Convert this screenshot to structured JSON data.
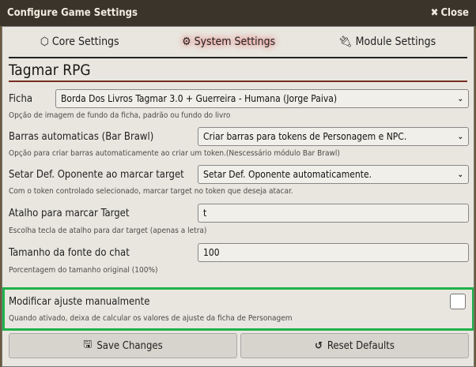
{
  "window": {
    "title": "Configure Game Settings",
    "close_label": "Close"
  },
  "tabs": [
    {
      "label": "Core Settings",
      "icon": "d20-icon"
    },
    {
      "label": "System Settings",
      "icon": "gears-icon",
      "active": true
    },
    {
      "label": "Module Settings",
      "icon": "plug-icon"
    }
  ],
  "section_title": "Tagmar RPG",
  "settings": [
    {
      "label": "Ficha",
      "value": "Borda Dos Livros Tagmar 3.0 + Guerreira - Humana (Jorge Paiva)",
      "hint": "Opção de imagem de fundo da ficha, padrão ou fundo do livro"
    },
    {
      "label": "Barras automaticas (Bar Brawl)",
      "value": "Criar barras para tokens de Personagem e NPC.",
      "hint": "Opção para criar barras automaticamente ao criar um token.(Nescessário módulo Bar Brawl)"
    },
    {
      "label": "Setar Def. Oponente ao marcar target",
      "value": "Setar Def. Oponente automaticamente.",
      "hint": "Com o token controlado selecionado, marcar target no token que deseja atacar."
    },
    {
      "label": "Atalho para marcar Target",
      "value": "t",
      "hint": "Escolha tecla de atalho para dar target (apenas a letra)"
    },
    {
      "label": "Tamanho da fonte do chat",
      "value": "100",
      "hint": "Porcentagem do tamanho original (100%)"
    },
    {
      "label": "Modificar ajuste manualmente",
      "checked": false,
      "hint": "Quando ativado, deixa de calcular os valores de ajuste da ficha de Personagem"
    }
  ],
  "footer": {
    "save_label": "Save Changes",
    "reset_label": "Reset Defaults"
  },
  "colors": {
    "highlight": "#1fb24a",
    "accent": "#782e22"
  }
}
